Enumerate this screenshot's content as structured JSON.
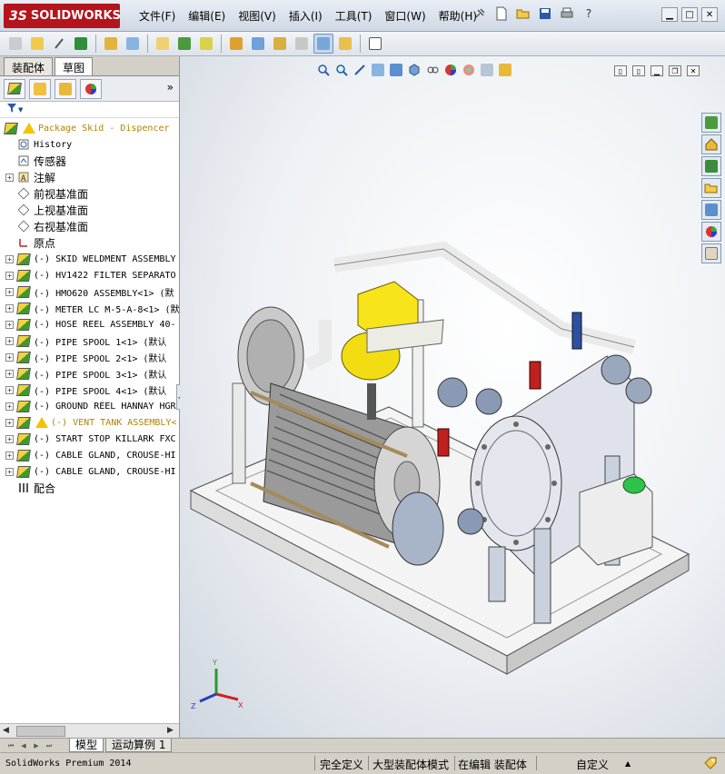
{
  "app": {
    "brand": "SOLIDWORKS",
    "brand_prefix": "3S"
  },
  "menu": {
    "items": [
      "文件(F)",
      "编辑(E)",
      "视图(V)",
      "插入(I)",
      "工具(T)",
      "窗口(W)",
      "帮助(H)"
    ]
  },
  "panel": {
    "tabs": [
      "装配体",
      "草图"
    ],
    "more": "»",
    "filter_icon": "▼"
  },
  "tree": {
    "root": "Package Skid - Dispencer",
    "items": [
      {
        "label": "History",
        "icon": "history-icon",
        "expand": false
      },
      {
        "label": "传感器",
        "icon": "sensor-icon",
        "expand": false
      },
      {
        "label": "注解",
        "icon": "annotation-icon",
        "expand": true
      },
      {
        "label": "前视基准面",
        "icon": "plane-icon",
        "expand": false
      },
      {
        "label": "上视基准面",
        "icon": "plane-icon",
        "expand": false
      },
      {
        "label": "右视基准面",
        "icon": "plane-icon",
        "expand": false
      },
      {
        "label": "原点",
        "icon": "origin-icon",
        "expand": false
      },
      {
        "label": "(-) SKID WELDMENT ASSEMBLY",
        "icon": "assembly-icon",
        "expand": true
      },
      {
        "label": "(-) HV1422 FILTER SEPARATO",
        "icon": "assembly-icon",
        "expand": true
      },
      {
        "label": "(-) HMO620 ASSEMBLY<1> (默",
        "icon": "assembly-icon",
        "expand": true
      },
      {
        "label": "(-) METER LC M-5-A-8<1> (默",
        "icon": "assembly-icon",
        "expand": true
      },
      {
        "label": "(-) HOSE REEL ASSEMBLY 40-",
        "icon": "assembly-icon",
        "expand": true
      },
      {
        "label": "(-) PIPE SPOOL 1<1> (默认",
        "icon": "assembly-icon",
        "expand": true
      },
      {
        "label": "(-) PIPE SPOOL 2<1> (默认",
        "icon": "assembly-icon",
        "expand": true
      },
      {
        "label": "(-) PIPE SPOOL 3<1> (默认",
        "icon": "assembly-icon",
        "expand": true
      },
      {
        "label": "(-) PIPE SPOOL 4<1> (默认",
        "icon": "assembly-icon",
        "expand": true
      },
      {
        "label": "(-) GROUND REEL HANNAY HGR",
        "icon": "assembly-icon",
        "expand": true
      },
      {
        "label": "(-) VENT TANK ASSEMBLY<",
        "icon": "assembly-icon",
        "expand": true,
        "warn": true
      },
      {
        "label": "(-) START STOP KILLARK FXC",
        "icon": "assembly-icon",
        "expand": true
      },
      {
        "label": "(-) CABLE GLAND, CROUSE-HI",
        "icon": "assembly-icon",
        "expand": true
      },
      {
        "label": "(-) CABLE GLAND, CROUSE-HI",
        "icon": "assembly-icon",
        "expand": true
      },
      {
        "label": "配合",
        "icon": "mates-icon",
        "expand": false
      }
    ]
  },
  "bottom_tabs": [
    "模型",
    "运动算例 1"
  ],
  "status": {
    "product": "SolidWorks Premium 2014",
    "state": "完全定义",
    "mode": "大型装配体模式",
    "editing": "在编辑 装配体",
    "units": "自定义"
  },
  "triad": {
    "x": "X",
    "y": "Y",
    "z": "Z"
  },
  "colors": {
    "accent": "#b4141c",
    "tree_warn": "#b08400"
  }
}
